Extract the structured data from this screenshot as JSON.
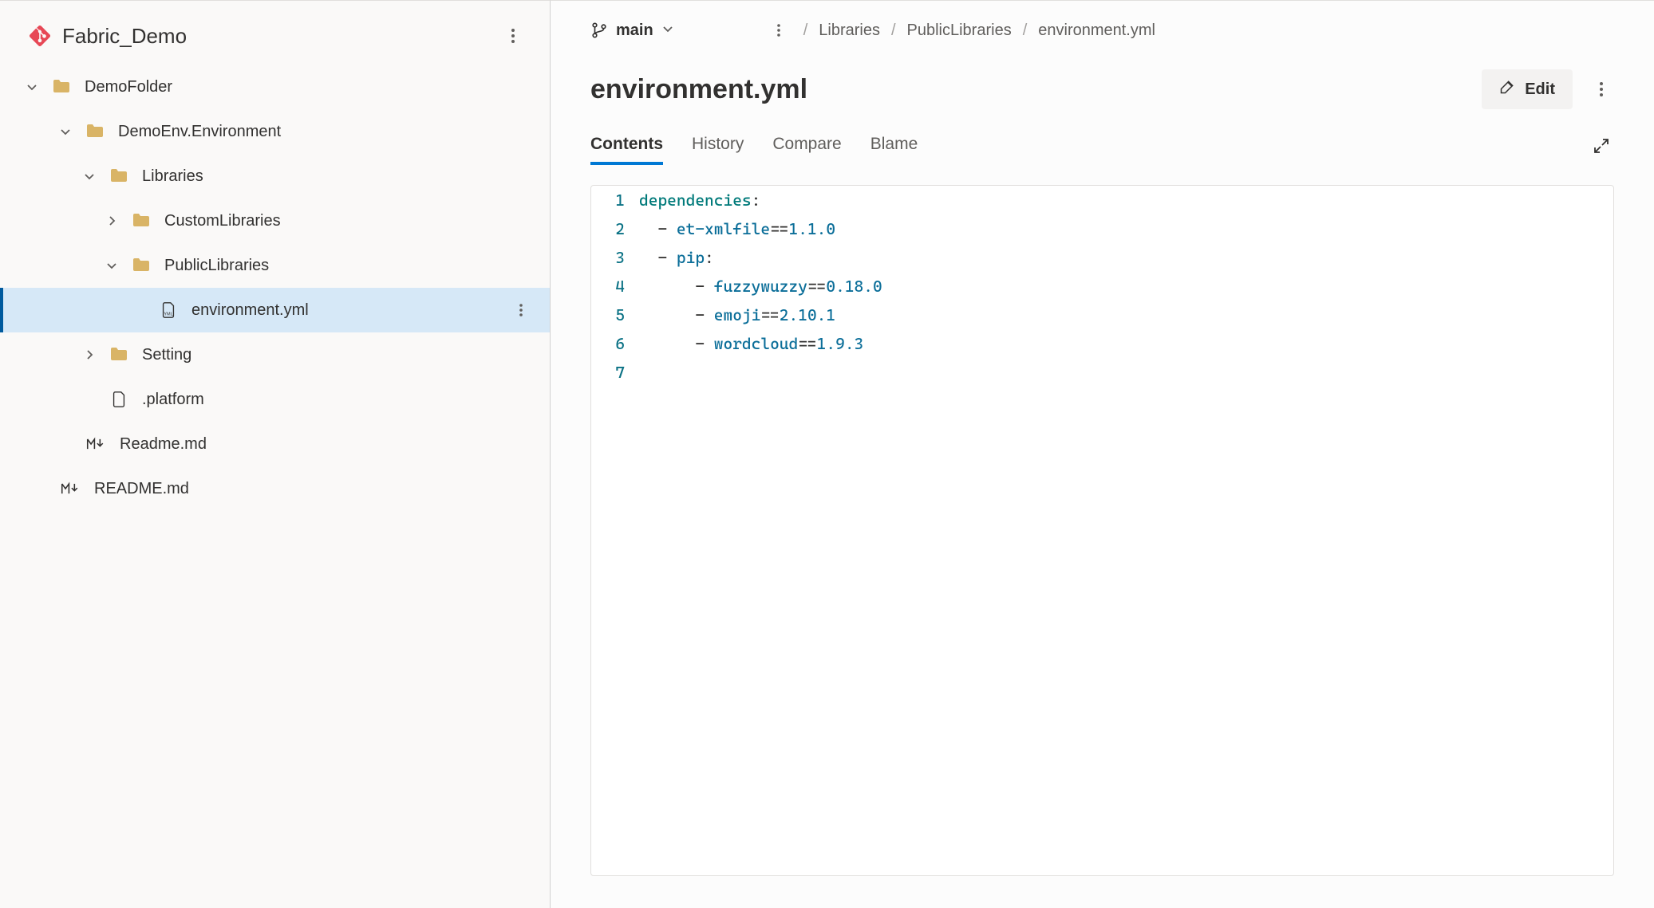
{
  "repo": {
    "name": "Fabric_Demo"
  },
  "tree": {
    "demoFolder": "DemoFolder",
    "demoEnv": "DemoEnv.Environment",
    "libraries": "Libraries",
    "customLibraries": "CustomLibraries",
    "publicLibraries": "PublicLibraries",
    "environmentYml": "environment.yml",
    "setting": "Setting",
    "platform": ".platform",
    "readmeLower": "Readme.md",
    "readmeUpper": "README.md"
  },
  "branch": {
    "label": "main"
  },
  "breadcrumb": {
    "items": [
      "Libraries",
      "PublicLibraries",
      "environment.yml"
    ]
  },
  "file": {
    "title": "environment.yml"
  },
  "actions": {
    "edit": "Edit"
  },
  "tabs": {
    "contents": "Contents",
    "history": "History",
    "compare": "Compare",
    "blame": "Blame"
  },
  "code": {
    "lines": [
      {
        "n": "1",
        "key": "dependencies",
        "after": ":"
      },
      {
        "n": "2",
        "prefix": "  - ",
        "pkg": "et-xmlfile",
        "eq": "==",
        "ver": "1.1.0"
      },
      {
        "n": "3",
        "prefix": "  - ",
        "pkg": "pip",
        "after": ":"
      },
      {
        "n": "4",
        "prefix": "      - ",
        "pkg": "fuzzywuzzy",
        "eq": "==",
        "ver": "0.18.0"
      },
      {
        "n": "5",
        "prefix": "      - ",
        "pkg": "emoji",
        "eq": "==",
        "ver": "2.10.1"
      },
      {
        "n": "6",
        "prefix": "      - ",
        "pkg": "wordcloud",
        "eq": "==",
        "ver": "1.9.3"
      },
      {
        "n": "7"
      }
    ]
  }
}
